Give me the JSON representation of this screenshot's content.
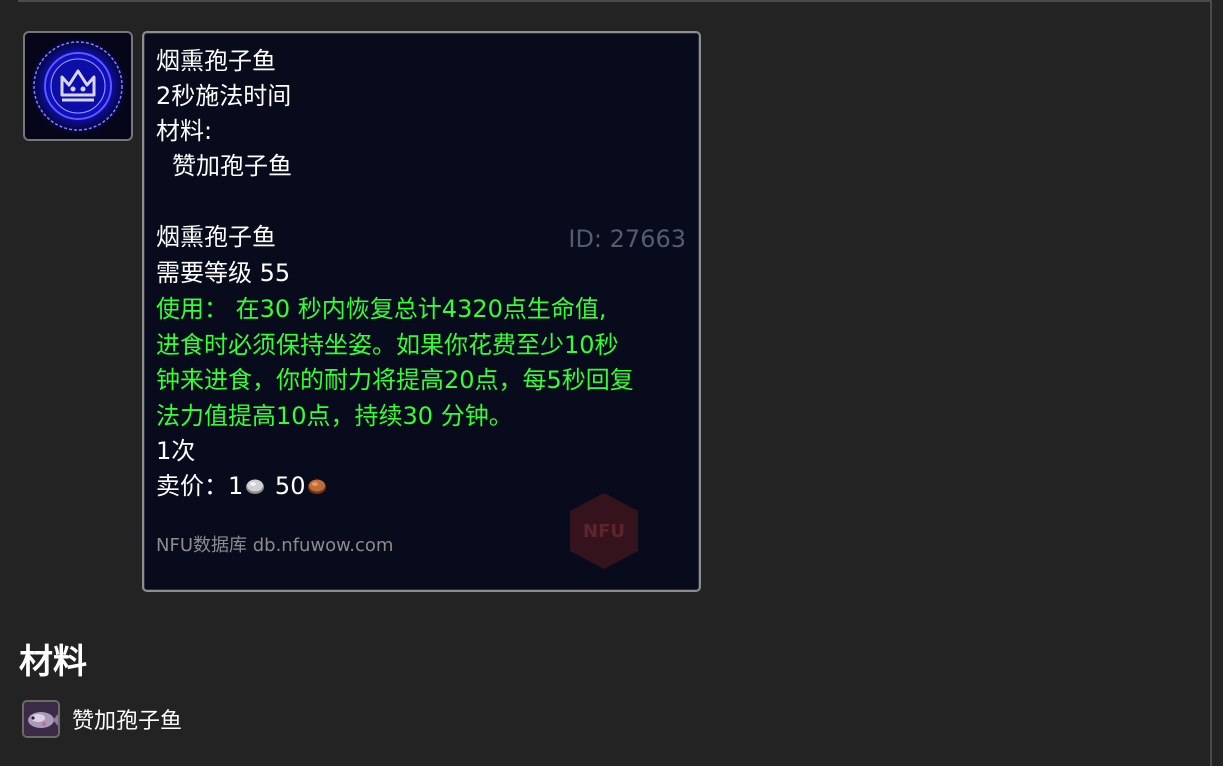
{
  "tooltip": {
    "spell_name": "烟熏孢子鱼",
    "cast_time": "2秒施法时间",
    "reagents_label": "材料:",
    "reagent_item": "赞加孢子鱼",
    "item_name": "烟熏孢子鱼",
    "item_id": "ID: 27663",
    "required_level": "需要等级 55",
    "use_lines": [
      "使用：  在30 秒内恢复总计4320点生命值,",
      "进食时必须保持坐姿。如果你花费至少10秒",
      "钟来进食，你的耐力将提高20点，每5秒回复",
      "法力值提高10点，持续30 分钟。"
    ],
    "charges": "1次",
    "sell_price_label": "卖价：",
    "sell_silver": "1",
    "sell_copper": "50",
    "credit": "NFU数据库 db.nfuwow.com",
    "watermark_text": "NFU"
  },
  "spell_icon": {
    "name": "cooking-crown-rune-icon",
    "accent": "#1a1aff"
  },
  "coins": {
    "silver_color": "#c9c9c9",
    "copper_color": "#b5673a"
  },
  "materials_section": {
    "title": "材料",
    "items": [
      {
        "label": "赞加孢子鱼",
        "icon": "spore-fish-icon"
      }
    ]
  }
}
